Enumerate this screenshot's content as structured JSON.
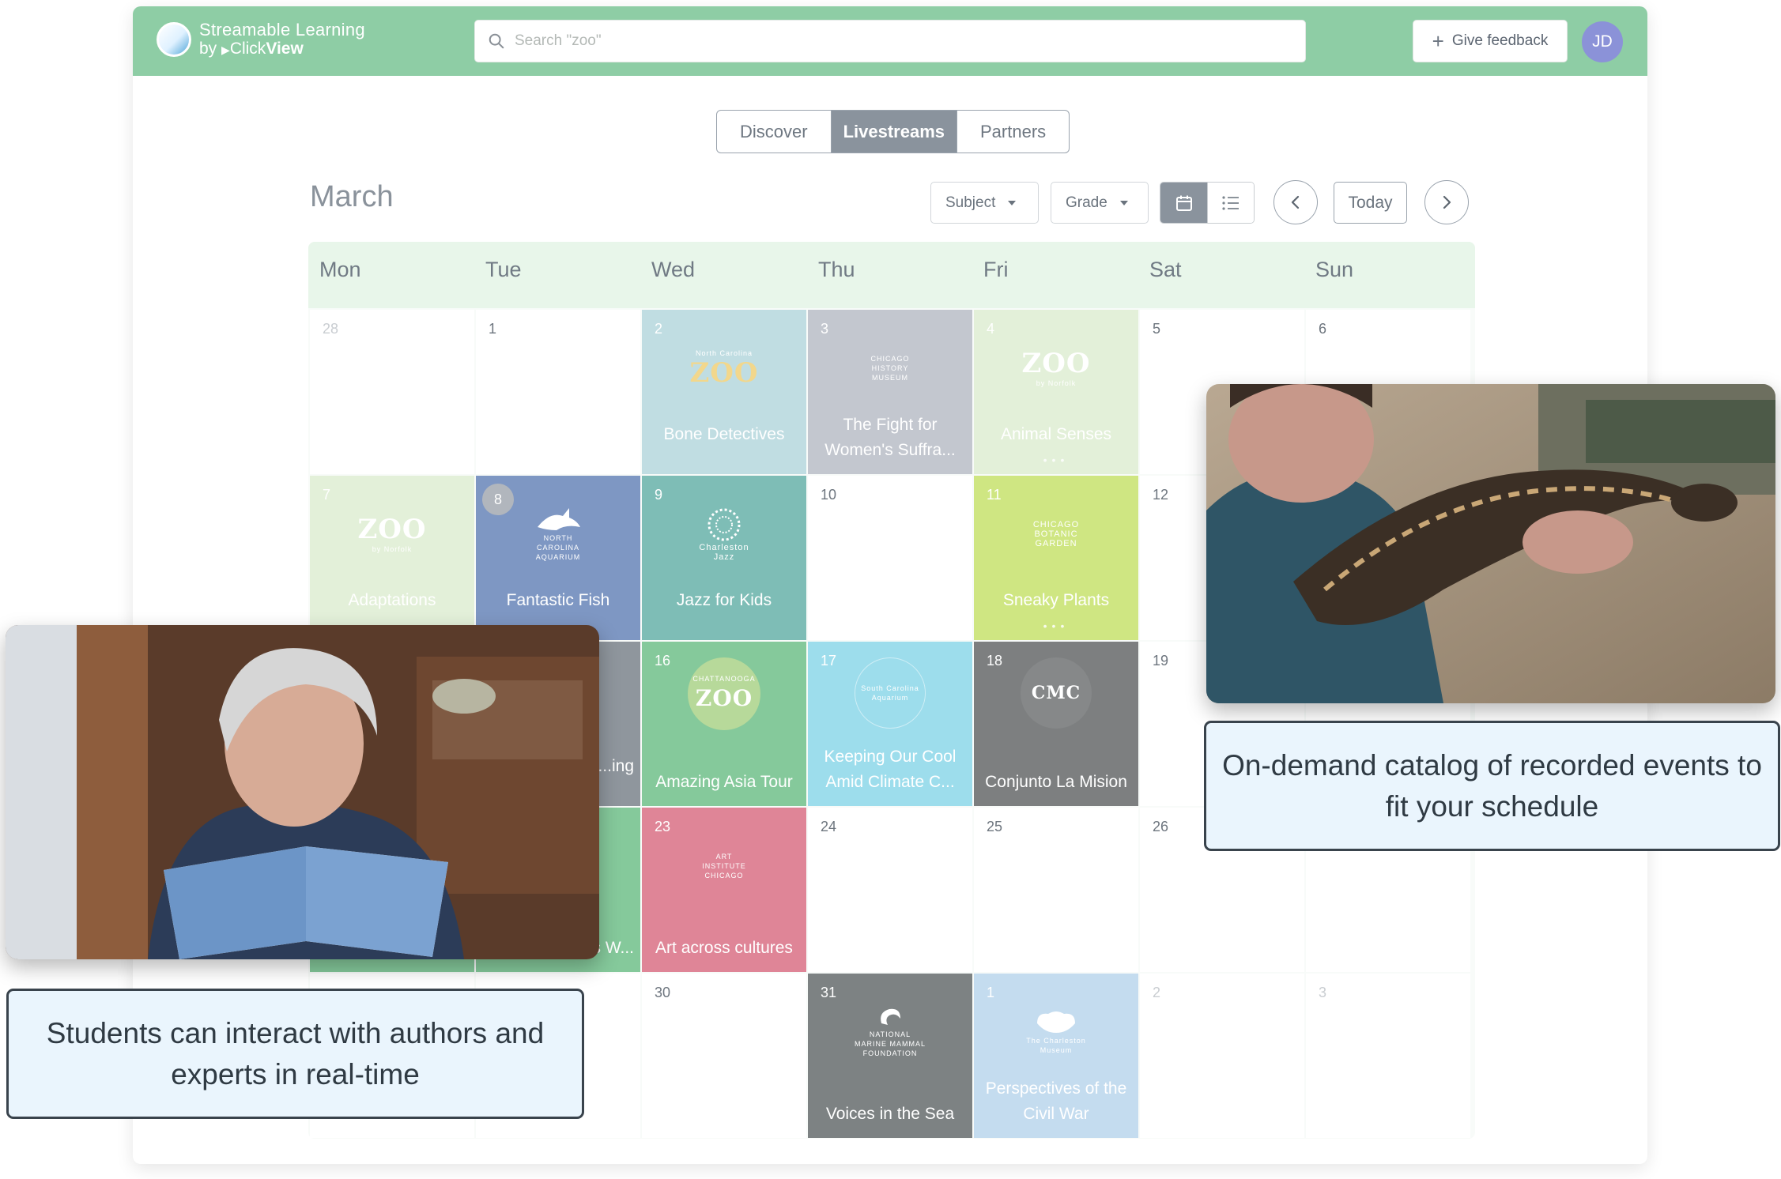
{
  "brand": {
    "name_line1": "Streamable Learning",
    "name_line2_prefix": "by",
    "name_line2_brand_a": "Click",
    "name_line2_brand_b": "View"
  },
  "search": {
    "placeholder": "Search \"zoo\"",
    "value": ""
  },
  "header": {
    "feedback_label": "Give feedback",
    "avatar_initials": "JD"
  },
  "tabs": [
    {
      "label": "Discover",
      "active": false
    },
    {
      "label": "Livestreams",
      "active": true
    },
    {
      "label": "Partners",
      "active": false
    }
  ],
  "calendar": {
    "month": "March",
    "filters": {
      "subject": "Subject",
      "grade": "Grade"
    },
    "today_label": "Today",
    "weekdays": [
      "Mon",
      "Tue",
      "Wed",
      "Thu",
      "Fri",
      "Sat",
      "Sun"
    ],
    "cells": {
      "r0c0": {
        "day": "28"
      },
      "r0c1": {
        "day": "1"
      },
      "r0c2": {
        "day": "2",
        "title": "Bone Detectives",
        "logo_top": "North Carolina",
        "logo_big": "ZOO"
      },
      "r0c3": {
        "day": "3",
        "title": "The Fight for Women's Suffra...",
        "logo_top": "CHICAGO HISTORY MUSEUM"
      },
      "r0c4": {
        "day": "4",
        "title": "Animal Senses",
        "logo_big": "ZOO",
        "logo_bottom": "by Norfolk"
      },
      "r0c5": {
        "day": "5"
      },
      "r0c6": {
        "day": "6"
      },
      "r1c0": {
        "day": "7",
        "title": "Adaptations",
        "logo_big": "ZOO",
        "logo_bottom": "by Norfolk"
      },
      "r1c1": {
        "day": "8",
        "title": "Fantastic Fish",
        "logo_top": "NORTH CAROLINA",
        "logo_bottom": "AQUARIUM"
      },
      "r1c2": {
        "day": "9",
        "title": "Jazz for Kids",
        "logo_top": "Charleston",
        "logo_bottom": "Jazz"
      },
      "r1c3": {
        "day": "10"
      },
      "r1c4": {
        "day": "11",
        "title": "Sneaky Plants",
        "logo_top": "CHICAGO",
        "logo_mid": "BOTANIC",
        "logo_bottom": "GARDEN"
      },
      "r1c5": {
        "day": "12"
      },
      "r2c1": {
        "title": "...ing"
      },
      "r2c2": {
        "day": "16",
        "title": "Amazing Asia Tour",
        "logo_top": "CHATTANOOGA",
        "logo_big": "ZOO"
      },
      "r2c3": {
        "day": "17",
        "title": "Keeping Our Cool Amid Climate C...",
        "logo_top": "South Carolina Aquarium"
      },
      "r2c4": {
        "day": "18",
        "title": "Conjunto La Mision",
        "logo_big": "CMC"
      },
      "r2c5": {
        "day": "19"
      },
      "r3c1": {
        "title": "...s W..."
      },
      "r3c2": {
        "day": "23",
        "title": "Art across cultures",
        "logo_top": "ART",
        "logo_mid": "INSTITUTE",
        "logo_bottom": "CHICAGO"
      },
      "r3c3": {
        "day": "24"
      },
      "r3c4": {
        "day": "25"
      },
      "r3c5": {
        "day": "26"
      },
      "r4c2": {
        "day": "30"
      },
      "r4c3": {
        "day": "31",
        "title": "Voices in the Sea",
        "logo_top": "NATIONAL",
        "logo_mid": "MARINE MAMMAL",
        "logo_bottom": "FOUNDATION"
      },
      "r4c4": {
        "day": "1",
        "title": "Perspectives of the Civil War",
        "logo_top": "The Charleston Museum"
      },
      "r4c5": {
        "day": "2"
      },
      "r4c6": {
        "day": "3"
      }
    }
  },
  "captions": {
    "right": "On-demand catalog of recorded events to fit your schedule",
    "left": "Students can interact with authors and experts in real-time"
  },
  "colors": {
    "topbar": "#8ecda5",
    "bone_detectives": "#c0dde2",
    "fight_suffrage": "#c3c7cf",
    "animal_senses": "#e3f0d9",
    "adaptations": "#e3f0d9",
    "fantastic_fish": "#7e97c3",
    "jazz_kids": "#7ebdb6",
    "sneaky_plants": "#cfe682",
    "amazing_asia": "#85c99b",
    "keeping_cool": "#9dddec",
    "conjunto": "#7d7f80",
    "art_cultures": "#df8597",
    "voices_sea": "#7d8283",
    "perspectives": "#c4dcef"
  }
}
